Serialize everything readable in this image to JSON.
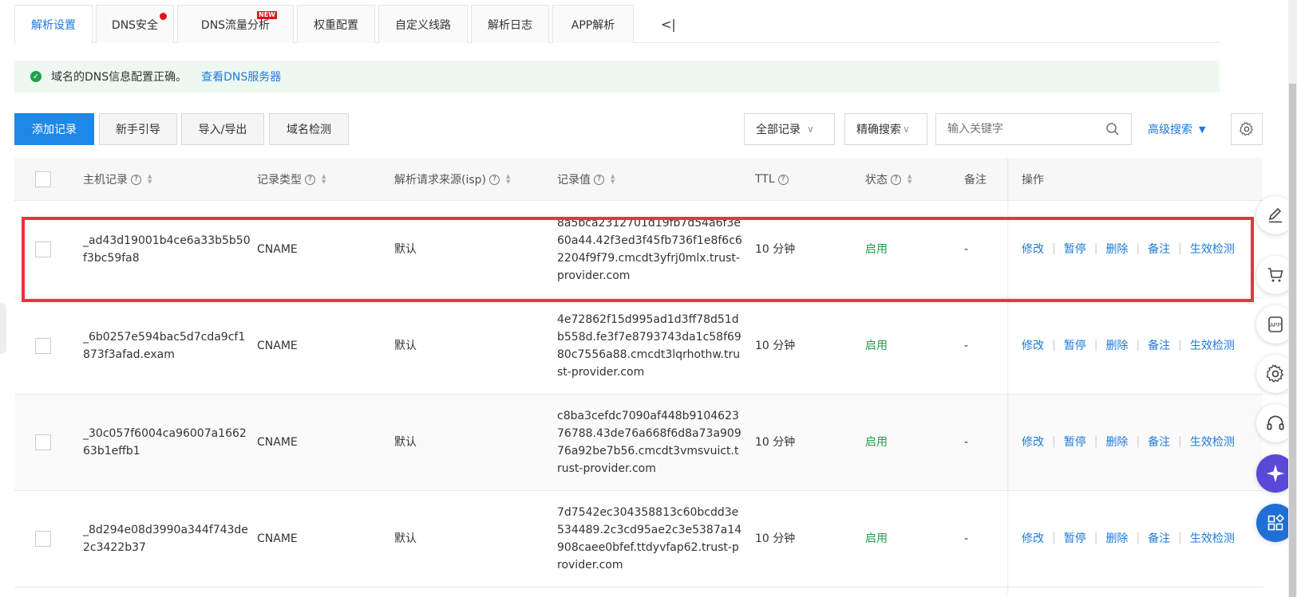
{
  "tabs": [
    {
      "label": "解析设置",
      "active": true
    },
    {
      "label": "DNS安全",
      "badge": "dot"
    },
    {
      "label": "DNS流量分析",
      "badge": "NEW"
    },
    {
      "label": "权重配置"
    },
    {
      "label": "自定义线路"
    },
    {
      "label": "解析日志"
    },
    {
      "label": "APP解析"
    }
  ],
  "tab_collapse": "<|",
  "alert": {
    "message": "域名的DNS信息配置正确。",
    "link": "查看DNS服务器"
  },
  "toolbar": {
    "add_record": "添加记录",
    "guide": "新手引导",
    "import_export": "导入/导出",
    "domain_check": "域名检测",
    "record_filter": "全部记录",
    "search_mode": "精确搜索",
    "search_placeholder": "输入关键字",
    "advanced_search": "高级搜索"
  },
  "table": {
    "headers": {
      "host": "主机记录",
      "type": "记录类型",
      "isp": "解析请求来源(isp)",
      "value": "记录值",
      "ttl": "TTL",
      "status": "状态",
      "remark": "备注",
      "ops": "操作"
    },
    "ops": [
      "修改",
      "暂停",
      "删除",
      "备注",
      "生效检测"
    ],
    "rows": [
      {
        "host": "_ad43d19001b4ce6a33b5b50f3bc59fa8",
        "type": "CNAME",
        "isp": "默认",
        "value": "8a5bca2312701d19fb7d54a6f3e60a44.42f3ed3f45fb736f1e8f6c62204f9f79.cmcdt3yfrj0mlx.trust-provider.com",
        "ttl": "10 分钟",
        "status": "启用",
        "remark": "-"
      },
      {
        "host": "_6b0257e594bac5d7cda9cf1873f3afad.exam",
        "type": "CNAME",
        "isp": "默认",
        "value": "4e72862f15d995ad1d3ff78d51db558d.fe3f7e8793743da1c58f6980c7556a88.cmcdt3lqrhothw.trust-provider.com",
        "ttl": "10 分钟",
        "status": "启用",
        "remark": "-"
      },
      {
        "host": "_30c057f6004ca96007a166263b1effb1",
        "type": "CNAME",
        "isp": "默认",
        "value": "c8ba3cefdc7090af448b910462376788.43de76a668f6d8a73a90976a92be7b56.cmcdt3vmsvuict.trust-provider.com",
        "ttl": "10 分钟",
        "status": "启用",
        "remark": "-"
      },
      {
        "host": "_8d294e08d3990a344f743de2c3422b37",
        "type": "CNAME",
        "isp": "默认",
        "value": "7d7542ec304358813c60bcdd3e534489.2c3cd95ae2c3e5387a14908caee0bfef.ttdyvfap62.trust-provider.com",
        "ttl": "10 分钟",
        "status": "启用",
        "remark": "-"
      }
    ]
  },
  "colors": {
    "accent": "#1f7ad9",
    "primary_button": "#1f87e6",
    "success": "#1f9f4a",
    "highlight": "#e8353b"
  },
  "dock_icons": [
    "edit-icon",
    "cart-icon",
    "app-icon",
    "gear-icon",
    "headset-icon",
    "ai-assistant-icon",
    "apps-grid-icon"
  ]
}
